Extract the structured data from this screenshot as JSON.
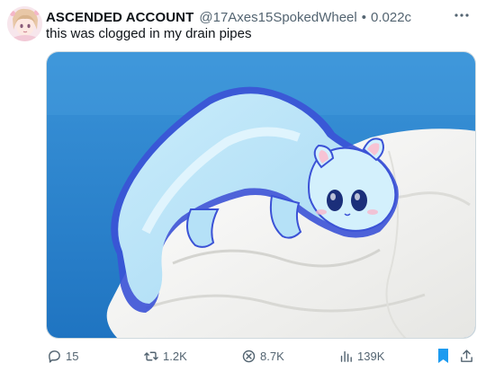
{
  "author": {
    "display_name": "ASCENDED ACCOUNT",
    "handle": "@17Axes15SpokedWheel",
    "separator": "•",
    "timestamp": "0.022c",
    "avatar_icon": "anime-avatar"
  },
  "tweet": {
    "text": "this was clogged in my drain pipes",
    "media_icon": "white-ferret-creature-image"
  },
  "actions": {
    "reply_count": "15",
    "repost_count": "1.2K",
    "like_count": "8.7K",
    "view_count": "139K",
    "bookmarked": true
  },
  "colors": {
    "text_primary": "#0f1419",
    "text_secondary": "#536471",
    "bookmark_active": "#1d9bf0",
    "media_background": "#2d89d0"
  }
}
